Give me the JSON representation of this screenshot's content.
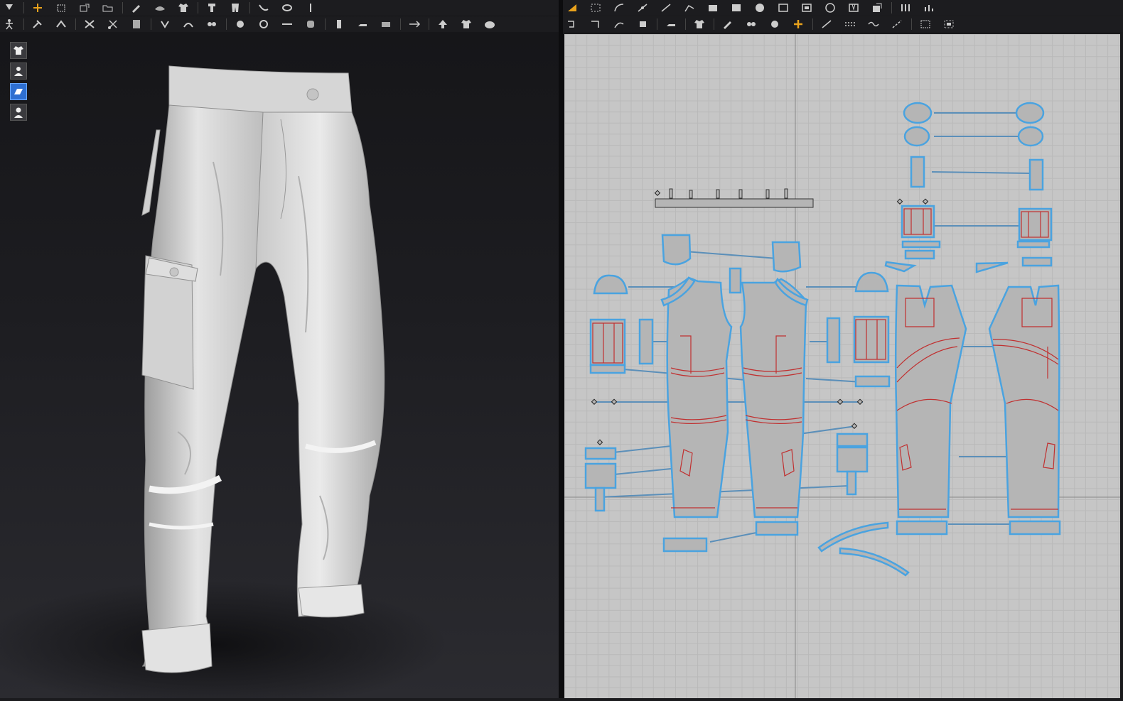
{
  "app": {
    "panels": [
      "3d-garment-window",
      "2d-pattern-window"
    ],
    "selected_avatar_tool": "garment-display-toggle"
  },
  "toolbar_3d_row1": [
    "select-move-icon",
    "transform-icon",
    "box-select-icon",
    "gizmo-icon",
    "folder-icon",
    "edit-pattern-icon",
    "fold-icon",
    "shirt-icon",
    "pose-icon",
    "pants-icon",
    "stitch-icon",
    "tack-icon",
    "measure-icon"
  ],
  "toolbar_3d_row2": [
    "avatar-pose-icon",
    "pin-icon",
    "arrange-icon",
    "fold-arrange-icon",
    "cut-icon",
    "ruler-icon",
    "button-icon",
    "buttonhole-icon",
    "zipper-icon",
    "topstitch-icon",
    "piping-icon",
    "trim-icon",
    "seam-tape-icon",
    "puckering-icon",
    "iron-icon",
    "fabric-icon",
    "sync-icon",
    "export-icon",
    "clothing-icon"
  ],
  "toolbar_2d_row1": [
    "adjust-icon",
    "transform-pattern-icon",
    "edit-curve-icon",
    "edit-point-icon",
    "add-point-icon",
    "polygon-icon",
    "rectangle-icon",
    "solid-rect-icon",
    "circle-icon",
    "internal-polygon-icon",
    "internal-rect-icon",
    "internal-circle-icon",
    "dart-icon",
    "trace-icon",
    "segment-sewing-icon",
    "free-sewing-icon"
  ],
  "toolbar_2d_row2": [
    "notch-icon",
    "edit-sewing-icon",
    "free-notch-icon",
    "pleat-icon",
    "iron-2d-icon",
    "sew-icon",
    "tack-2d-icon",
    "fold-2d-icon",
    "arrange-2d-icon",
    "snap-icon",
    "line-icon",
    "dash-icon",
    "curve-icon",
    "measure-2d-icon",
    "grid-icon",
    "select-all-icon"
  ],
  "side_tools": [
    {
      "icon": "garment-icon"
    },
    {
      "icon": "avatar-icon"
    },
    {
      "icon": "garment-display-toggle-icon"
    },
    {
      "icon": "silhouette-icon"
    }
  ],
  "colors": {
    "pattern_fill": "#b5b5b5",
    "pattern_outline_selected": "#4aa3e0",
    "internal_line": "#c03030",
    "sewing_line": "#5b8fb9",
    "grid_background": "#c6c6c6",
    "active_tool": "#2e6fd1",
    "garment_shading": "#d9d9d9"
  }
}
